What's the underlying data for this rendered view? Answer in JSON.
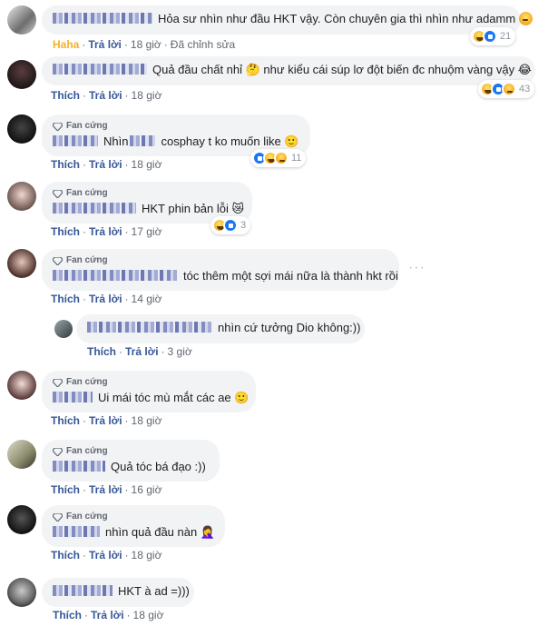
{
  "actions": {
    "like": "Thích",
    "reply": "Trả lời",
    "haha": "Haha",
    "edited": "Đã chỉnh sửa",
    "sep": "·"
  },
  "badge": {
    "fan": "Fan cứng"
  },
  "comments": [
    {
      "text": "Hỏa sư nhìn như đầu HKT vậy. Còn chuyên gia thì nhìn như adamm",
      "time": "18 giờ",
      "reactions": "21",
      "user_reaction": "Haha"
    },
    {
      "text": "Quả đầu chất nhỉ 🤔 như kiểu cái súp lơ đột biến đc nhuộm vàng vậy 😂",
      "time": "18 giờ",
      "reactions": "43"
    },
    {
      "text": "Nhìn",
      "text2": "cosphay t ko muốn like 🙂",
      "time": "18 giờ",
      "reactions": "11"
    },
    {
      "text": "HKT phin bản lỗi 😿",
      "time": "17 giờ",
      "reactions": "3"
    },
    {
      "text": "tóc thêm một sợi mái nữa là thành hkt rồi",
      "time": "14 giờ"
    },
    {
      "text": "nhìn cứ tưởng Dio không:))",
      "time": "3 giờ"
    },
    {
      "text": "Ui mái tóc mù mắt các ae 🙂",
      "time": "18 giờ"
    },
    {
      "text": "Quả tóc bá đạo :))",
      "time": "16 giờ"
    },
    {
      "text": "nhìn quả đầu nàn 🤦‍♀️",
      "time": "18 giờ"
    },
    {
      "text": "HKT à ad =)))",
      "time": "18 giờ"
    }
  ],
  "more_icon": "···"
}
